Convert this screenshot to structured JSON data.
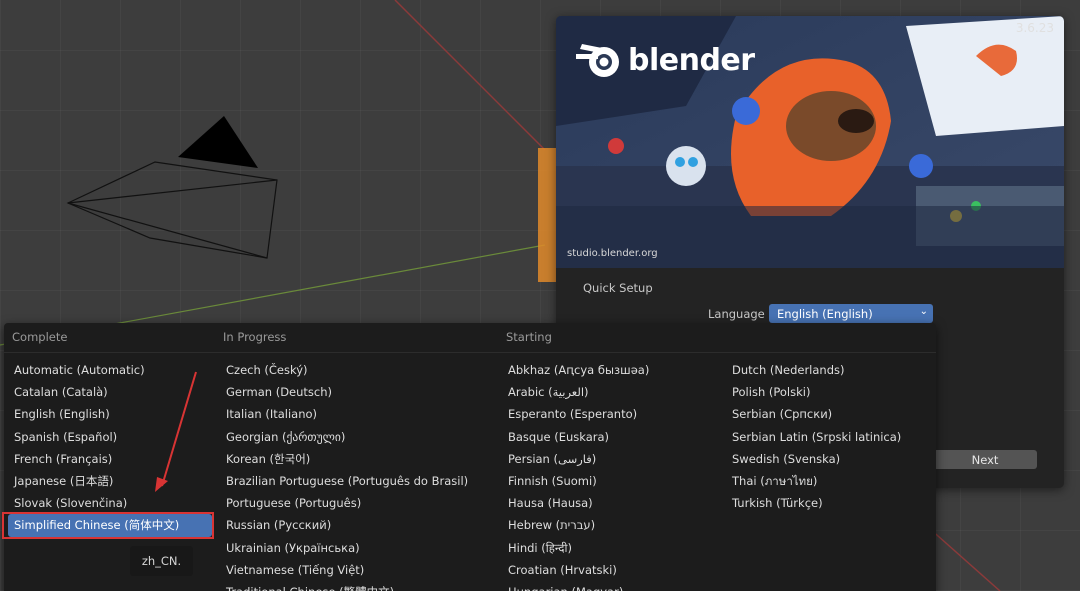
{
  "splash": {
    "version": "3.6.23",
    "logo_text": "blender",
    "art_credit": "studio.blender.org",
    "quick_setup_label": "Quick Setup",
    "language_label": "Language",
    "language_value": "English (English)",
    "next_label": "Next"
  },
  "menu": {
    "columns": [
      {
        "header": "Complete",
        "items": [
          "Automatic (Automatic)",
          "Catalan (Català)",
          "English (English)",
          "Spanish (Español)",
          "French (Français)",
          "Japanese (日本語)",
          "Slovak (Slovenčina)",
          "Simplified Chinese (简体中文)"
        ],
        "active_index": 7
      },
      {
        "header": "In Progress",
        "items": [
          "Czech (Český)",
          "German (Deutsch)",
          "Italian (Italiano)",
          "Georgian (ქართული)",
          "Korean (한국어)",
          "Brazilian Portuguese (Português do Brasil)",
          "Portuguese (Português)",
          "Russian (Русский)",
          "Ukrainian (Українська)",
          "Vietnamese (Tiếng Việt)",
          "Traditional Chinese (繁體中文)"
        ]
      },
      {
        "header": "Starting",
        "items": [
          "Abkhaz (Аԥсуа бызшәа)",
          "Arabic (العربية)",
          "Esperanto (Esperanto)",
          "Basque (Euskara)",
          "Persian (فارسی)",
          "Finnish (Suomi)",
          "Hausa (Hausa)",
          "Hebrew (עברית)",
          "Hindi (हिन्दी)",
          "Croatian (Hrvatski)",
          "Hungarian (Magyar)"
        ]
      },
      {
        "header": "",
        "items": [
          "Dutch (Nederlands)",
          "Polish (Polski)",
          "Serbian (Српски)",
          "Serbian Latin (Srpski latinica)",
          "Swedish (Svenska)",
          "Thai (ภาษาไทย)",
          "Turkish (Türkçe)"
        ]
      }
    ]
  },
  "tooltip": "zh_CN.",
  "colors": {
    "accent": "#4772b3",
    "annotation": "#d83434",
    "viewport": "#3d3d3d",
    "menu_bg": "#1c1c1c"
  }
}
